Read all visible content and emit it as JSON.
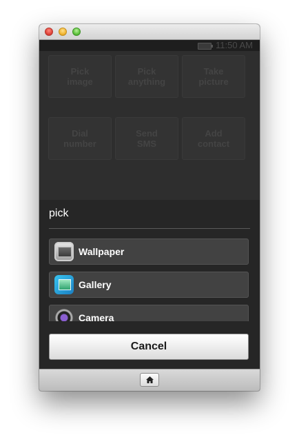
{
  "status_bar": {
    "time": "11:50 AM"
  },
  "background_buttons": [
    {
      "label": "Pick\nimage"
    },
    {
      "label": "Pick\nanything"
    },
    {
      "label": "Take\npicture"
    },
    {
      "label": "Dial\nnumber"
    },
    {
      "label": "Send\nSMS"
    },
    {
      "label": "Add\ncontact"
    }
  ],
  "dialog": {
    "title": "pick",
    "options": [
      {
        "label": "Wallpaper",
        "icon": "wallpaper-icon"
      },
      {
        "label": "Gallery",
        "icon": "gallery-icon"
      },
      {
        "label": "Camera",
        "icon": "camera-icon"
      }
    ],
    "cancel_label": "Cancel"
  },
  "bottom_bar": {
    "home_icon": "home-icon"
  }
}
